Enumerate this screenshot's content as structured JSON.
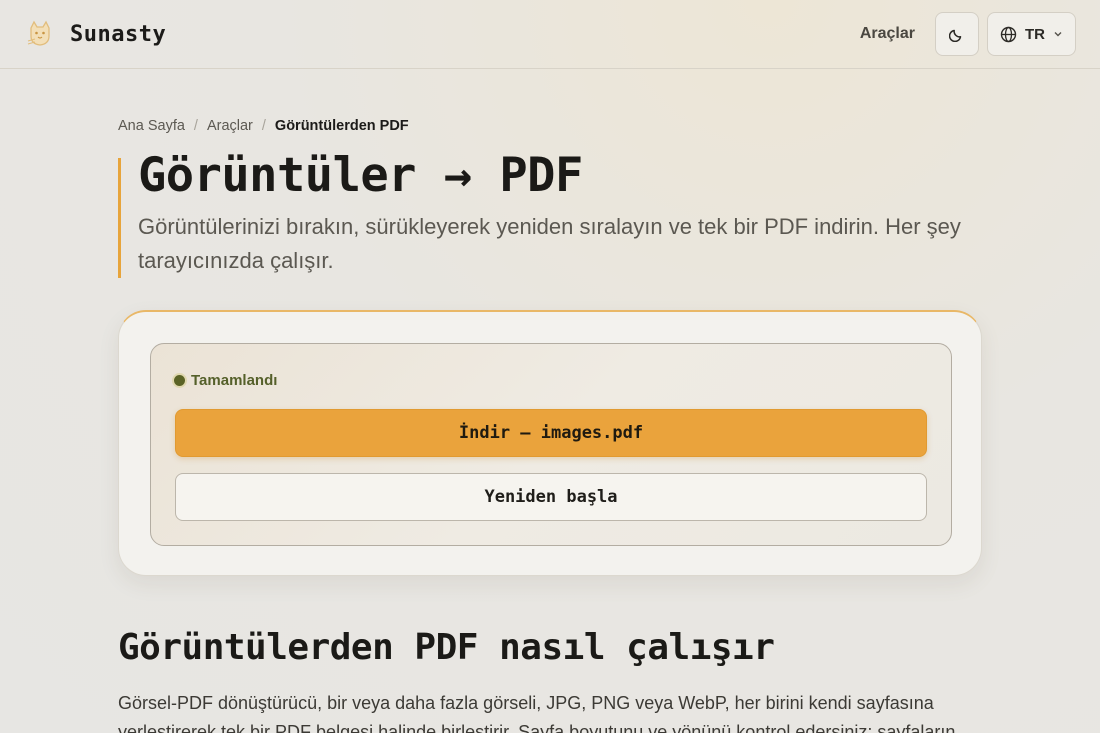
{
  "header": {
    "brand": "Sunasty",
    "nav_tools": "Araçlar",
    "theme_icon": "moon-icon",
    "language": "TR"
  },
  "breadcrumb": {
    "items": [
      "Ana Sayfa",
      "Araçlar",
      "Görüntülerden PDF"
    ],
    "separator": "/"
  },
  "hero": {
    "title": "Görüntüler → PDF",
    "subtitle": "Görüntülerinizi bırakın, sürükleyerek yeniden sıralayın ve tek bir PDF indirin. Her şey tarayıcınızda çalışır."
  },
  "result": {
    "status": "Tamamlandı",
    "download_label": "İndir — images.pdf",
    "restart_label": "Yeniden başla"
  },
  "section": {
    "heading": "Görüntülerden PDF nasıl çalışır",
    "body": "Görsel-PDF dönüştürücü, bir veya daha fazla görseli, JPG, PNG veya WebP, her birini kendi sayfasına yerleştirerek tek bir PDF belgesi halinde birleştirir. Sayfa boyutunu ve yönünü kontrol edersiniz; sayfaların"
  },
  "colors": {
    "accent": "#eaa33c",
    "status_green": "#5b6326",
    "background": "#e8e6e1"
  }
}
